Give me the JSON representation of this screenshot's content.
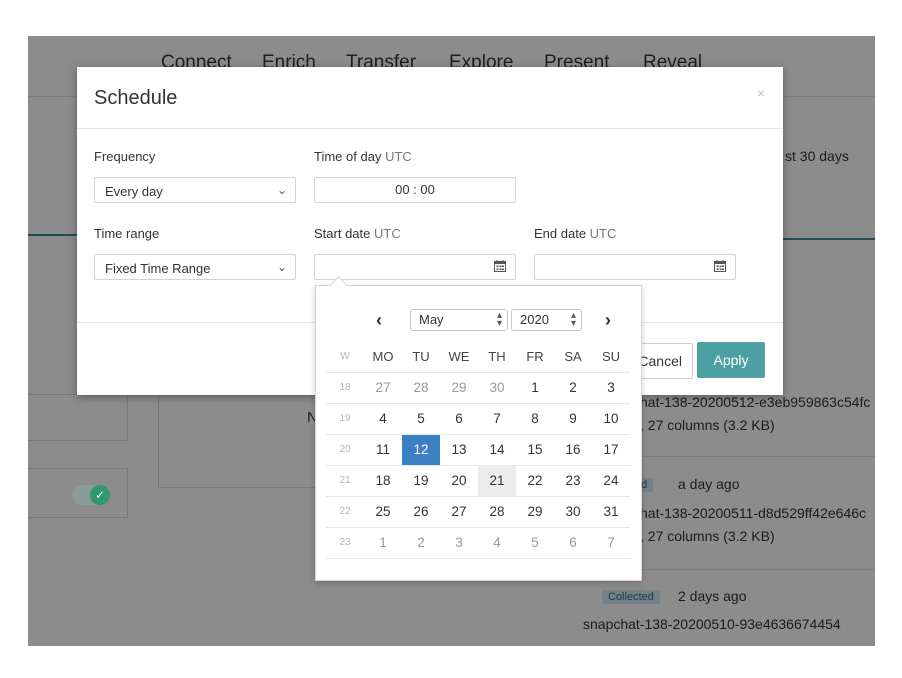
{
  "background": {
    "nav": [
      "Connect",
      "Enrich",
      "Transfer",
      "Explore",
      "Present",
      "Reveal"
    ],
    "side_text": "st 30 days",
    "items": [
      {
        "name": "hat-138-20200512-e3eb959863c54fc",
        "meta": ", 27 columns (3.2 KB)"
      },
      {
        "status": "ted",
        "time": "a day ago",
        "name": "hat-138-20200511-d8d529ff42e646c",
        "meta": ", 27 columns (3.2 KB)"
      },
      {
        "status": "Collected",
        "time": "2 days ago",
        "name": "snapchat-138-20200510-93e4636674454"
      }
    ]
  },
  "modal": {
    "title": "Schedule",
    "close": "×",
    "frequency_label": "Frequency",
    "frequency_value": "Every day",
    "time_label": "Time of day",
    "time_utc": "UTC",
    "time_value": "00 : 00",
    "range_label": "Time range",
    "range_value": "Fixed Time Range",
    "start_label": "Start date",
    "start_utc": "UTC",
    "end_label": "End date",
    "end_utc": "UTC",
    "cancel": "Cancel",
    "apply": "Apply"
  },
  "datepicker": {
    "month": "May",
    "year": "2020",
    "headers": [
      "W",
      "MO",
      "TU",
      "WE",
      "TH",
      "FR",
      "SA",
      "SU"
    ],
    "weeks": [
      [
        "18",
        "27",
        "28",
        "29",
        "30",
        "1",
        "2",
        "3"
      ],
      [
        "19",
        "4",
        "5",
        "6",
        "7",
        "8",
        "9",
        "10"
      ],
      [
        "20",
        "11",
        "12",
        "13",
        "14",
        "15",
        "16",
        "17"
      ],
      [
        "21",
        "18",
        "19",
        "20",
        "21",
        "22",
        "23",
        "24"
      ],
      [
        "22",
        "25",
        "26",
        "27",
        "28",
        "29",
        "30",
        "31"
      ],
      [
        "23",
        "1",
        "2",
        "3",
        "4",
        "5",
        "6",
        "7"
      ]
    ],
    "selected": "12",
    "today": "21"
  }
}
